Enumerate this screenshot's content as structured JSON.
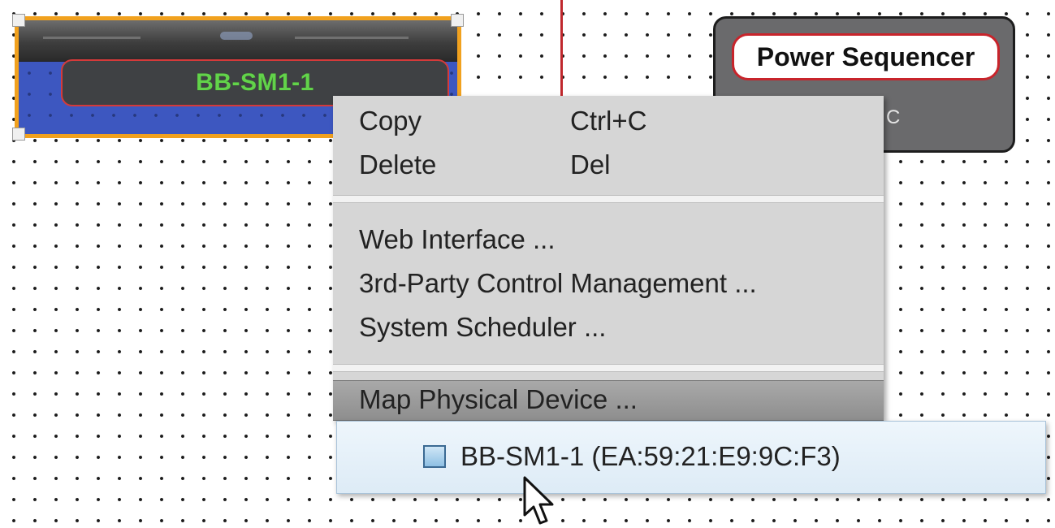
{
  "device": {
    "name": "BB-SM1-1"
  },
  "power_block": {
    "title": "Power Sequencer",
    "subtitle_visible": "C"
  },
  "context_menu": {
    "items": [
      {
        "label": "Copy",
        "shortcut": "Ctrl+C"
      },
      {
        "label": "Delete",
        "shortcut": "Del"
      },
      {
        "label": "Web Interface ..."
      },
      {
        "label": "3rd-Party Control Management ..."
      },
      {
        "label": "System Scheduler ..."
      },
      {
        "label": "Map Physical Device ..."
      }
    ]
  },
  "submenu": {
    "device_entry": "BB-SM1-1 (EA:59:21:E9:9C:F3)"
  },
  "colors": {
    "accent_orange": "#f1a11e",
    "device_blue": "#3d57c0",
    "device_label_green": "#62d34a",
    "outline_red": "#c8242b",
    "menu_bg": "#d6d6d6",
    "submenu_bg": "#e6f0f8"
  },
  "icons": {
    "cursor": "mouse-pointer-icon",
    "checkbox": "checkbox-icon"
  }
}
